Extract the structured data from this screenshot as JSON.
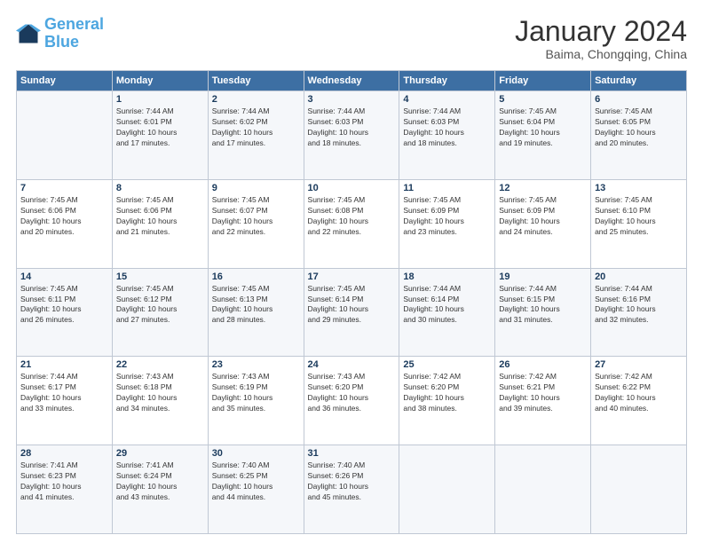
{
  "header": {
    "logo_general": "General",
    "logo_blue": "Blue",
    "month_title": "January 2024",
    "location": "Baima, Chongqing, China"
  },
  "weekdays": [
    "Sunday",
    "Monday",
    "Tuesday",
    "Wednesday",
    "Thursday",
    "Friday",
    "Saturday"
  ],
  "weeks": [
    [
      {
        "day": "",
        "info": ""
      },
      {
        "day": "1",
        "info": "Sunrise: 7:44 AM\nSunset: 6:01 PM\nDaylight: 10 hours\nand 17 minutes."
      },
      {
        "day": "2",
        "info": "Sunrise: 7:44 AM\nSunset: 6:02 PM\nDaylight: 10 hours\nand 17 minutes."
      },
      {
        "day": "3",
        "info": "Sunrise: 7:44 AM\nSunset: 6:03 PM\nDaylight: 10 hours\nand 18 minutes."
      },
      {
        "day": "4",
        "info": "Sunrise: 7:44 AM\nSunset: 6:03 PM\nDaylight: 10 hours\nand 18 minutes."
      },
      {
        "day": "5",
        "info": "Sunrise: 7:45 AM\nSunset: 6:04 PM\nDaylight: 10 hours\nand 19 minutes."
      },
      {
        "day": "6",
        "info": "Sunrise: 7:45 AM\nSunset: 6:05 PM\nDaylight: 10 hours\nand 20 minutes."
      }
    ],
    [
      {
        "day": "7",
        "info": "Sunrise: 7:45 AM\nSunset: 6:06 PM\nDaylight: 10 hours\nand 20 minutes."
      },
      {
        "day": "8",
        "info": "Sunrise: 7:45 AM\nSunset: 6:06 PM\nDaylight: 10 hours\nand 21 minutes."
      },
      {
        "day": "9",
        "info": "Sunrise: 7:45 AM\nSunset: 6:07 PM\nDaylight: 10 hours\nand 22 minutes."
      },
      {
        "day": "10",
        "info": "Sunrise: 7:45 AM\nSunset: 6:08 PM\nDaylight: 10 hours\nand 22 minutes."
      },
      {
        "day": "11",
        "info": "Sunrise: 7:45 AM\nSunset: 6:09 PM\nDaylight: 10 hours\nand 23 minutes."
      },
      {
        "day": "12",
        "info": "Sunrise: 7:45 AM\nSunset: 6:09 PM\nDaylight: 10 hours\nand 24 minutes."
      },
      {
        "day": "13",
        "info": "Sunrise: 7:45 AM\nSunset: 6:10 PM\nDaylight: 10 hours\nand 25 minutes."
      }
    ],
    [
      {
        "day": "14",
        "info": "Sunrise: 7:45 AM\nSunset: 6:11 PM\nDaylight: 10 hours\nand 26 minutes."
      },
      {
        "day": "15",
        "info": "Sunrise: 7:45 AM\nSunset: 6:12 PM\nDaylight: 10 hours\nand 27 minutes."
      },
      {
        "day": "16",
        "info": "Sunrise: 7:45 AM\nSunset: 6:13 PM\nDaylight: 10 hours\nand 28 minutes."
      },
      {
        "day": "17",
        "info": "Sunrise: 7:45 AM\nSunset: 6:14 PM\nDaylight: 10 hours\nand 29 minutes."
      },
      {
        "day": "18",
        "info": "Sunrise: 7:44 AM\nSunset: 6:14 PM\nDaylight: 10 hours\nand 30 minutes."
      },
      {
        "day": "19",
        "info": "Sunrise: 7:44 AM\nSunset: 6:15 PM\nDaylight: 10 hours\nand 31 minutes."
      },
      {
        "day": "20",
        "info": "Sunrise: 7:44 AM\nSunset: 6:16 PM\nDaylight: 10 hours\nand 32 minutes."
      }
    ],
    [
      {
        "day": "21",
        "info": "Sunrise: 7:44 AM\nSunset: 6:17 PM\nDaylight: 10 hours\nand 33 minutes."
      },
      {
        "day": "22",
        "info": "Sunrise: 7:43 AM\nSunset: 6:18 PM\nDaylight: 10 hours\nand 34 minutes."
      },
      {
        "day": "23",
        "info": "Sunrise: 7:43 AM\nSunset: 6:19 PM\nDaylight: 10 hours\nand 35 minutes."
      },
      {
        "day": "24",
        "info": "Sunrise: 7:43 AM\nSunset: 6:20 PM\nDaylight: 10 hours\nand 36 minutes."
      },
      {
        "day": "25",
        "info": "Sunrise: 7:42 AM\nSunset: 6:20 PM\nDaylight: 10 hours\nand 38 minutes."
      },
      {
        "day": "26",
        "info": "Sunrise: 7:42 AM\nSunset: 6:21 PM\nDaylight: 10 hours\nand 39 minutes."
      },
      {
        "day": "27",
        "info": "Sunrise: 7:42 AM\nSunset: 6:22 PM\nDaylight: 10 hours\nand 40 minutes."
      }
    ],
    [
      {
        "day": "28",
        "info": "Sunrise: 7:41 AM\nSunset: 6:23 PM\nDaylight: 10 hours\nand 41 minutes."
      },
      {
        "day": "29",
        "info": "Sunrise: 7:41 AM\nSunset: 6:24 PM\nDaylight: 10 hours\nand 43 minutes."
      },
      {
        "day": "30",
        "info": "Sunrise: 7:40 AM\nSunset: 6:25 PM\nDaylight: 10 hours\nand 44 minutes."
      },
      {
        "day": "31",
        "info": "Sunrise: 7:40 AM\nSunset: 6:26 PM\nDaylight: 10 hours\nand 45 minutes."
      },
      {
        "day": "",
        "info": ""
      },
      {
        "day": "",
        "info": ""
      },
      {
        "day": "",
        "info": ""
      }
    ]
  ]
}
